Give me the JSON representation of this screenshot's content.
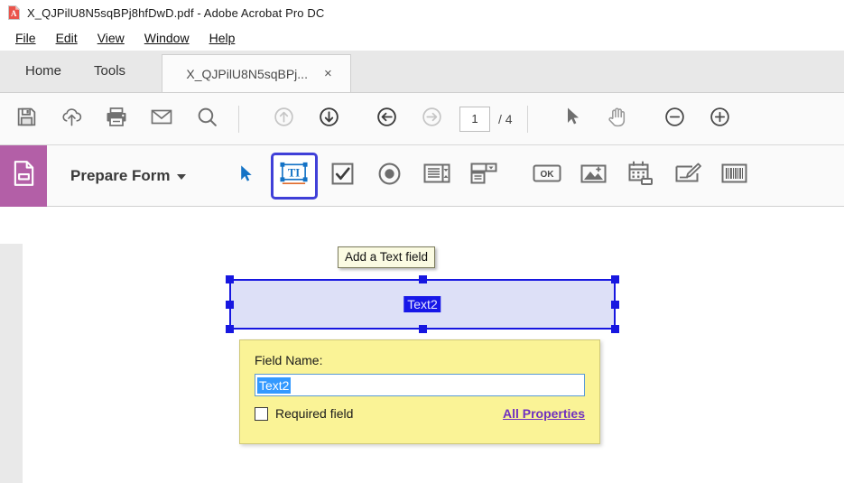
{
  "window": {
    "title": "X_QJPilU8N5sqBPj8hfDwD.pdf - Adobe Acrobat Pro DC",
    "app_icon": "acrobat-logo-icon"
  },
  "menubar": {
    "items": [
      {
        "label": "File",
        "accel": "F"
      },
      {
        "label": "Edit",
        "accel": "E"
      },
      {
        "label": "View",
        "accel": "V"
      },
      {
        "label": "Window",
        "accel": "W"
      },
      {
        "label": "Help",
        "accel": "H"
      }
    ]
  },
  "tabstrip": {
    "home_label": "Home",
    "tools_label": "Tools",
    "document_tab_label": "X_QJPilU8N5sqBPj...",
    "close_glyph": "×"
  },
  "toolbar": {
    "buttons": [
      {
        "name": "save-icon",
        "title": "Save"
      },
      {
        "name": "cloud-upload-icon",
        "title": "Save to cloud"
      },
      {
        "name": "print-icon",
        "title": "Print"
      },
      {
        "name": "email-icon",
        "title": "Email"
      },
      {
        "name": "search-icon",
        "title": "Find"
      },
      {
        "name": "arrow-up-icon",
        "title": "Previous page"
      },
      {
        "name": "arrow-down-icon",
        "title": "Next page"
      },
      {
        "name": "arrow-back-icon",
        "title": "Previous view"
      },
      {
        "name": "arrow-forward-icon",
        "title": "Next view"
      },
      {
        "name": "select-cursor-icon",
        "title": "Select tool"
      },
      {
        "name": "hand-icon",
        "title": "Hand tool"
      },
      {
        "name": "zoom-out-icon",
        "title": "Zoom out"
      },
      {
        "name": "zoom-in-icon",
        "title": "Zoom in"
      }
    ],
    "page_number": "1",
    "page_total": "/ 4"
  },
  "formbar": {
    "panel_icon": "prepare-form-document-icon",
    "title": "Prepare Form",
    "tools": [
      {
        "name": "select-object-icon",
        "label": "Select object"
      },
      {
        "name": "text-field-icon",
        "label": "Add a Text field",
        "selected": true
      },
      {
        "name": "checkbox-icon",
        "label": "Add a Check Box"
      },
      {
        "name": "radio-button-icon",
        "label": "Add a Radio Button"
      },
      {
        "name": "list-box-icon",
        "label": "Add a List Box"
      },
      {
        "name": "dropdown-icon",
        "label": "Add a Dropdown"
      },
      {
        "name": "button-ok-icon",
        "label": "Add a Button"
      },
      {
        "name": "image-field-icon",
        "label": "Add an Image Field"
      },
      {
        "name": "date-field-icon",
        "label": "Add a Date Field"
      },
      {
        "name": "signature-field-icon",
        "label": "Add a Digital Signature"
      },
      {
        "name": "barcode-icon",
        "label": "Add a Barcode"
      }
    ]
  },
  "tooltip": {
    "text": "Add a Text field"
  },
  "form_field": {
    "label": "Text2"
  },
  "popup": {
    "field_name_label": "Field Name:",
    "field_name_value": "Text2",
    "required_label": "Required field",
    "required_checked": false,
    "all_properties_label": "All Properties"
  },
  "colors": {
    "accent_purple": "#b35fa7",
    "selection_blue": "#1717e0",
    "popup_yellow": "#faf396",
    "link_purple": "#7030c0",
    "text_highlight": "#3399ff"
  }
}
